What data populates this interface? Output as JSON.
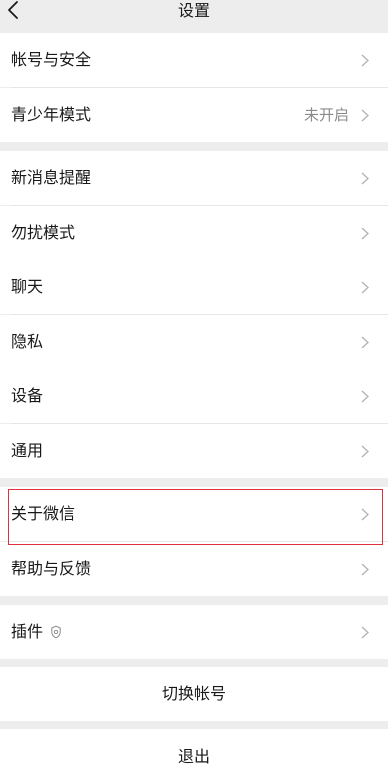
{
  "nav": {
    "title": "设置",
    "back_icon": "chevron-left-icon"
  },
  "sections": [
    {
      "items": [
        {
          "label": "帐号与安全",
          "value": ""
        },
        {
          "label": "青少年模式",
          "value": "未开启"
        }
      ]
    },
    {
      "items": [
        {
          "label": "新消息提醒"
        },
        {
          "label": "勿扰模式"
        },
        {
          "label": "聊天"
        },
        {
          "label": "隐私"
        },
        {
          "label": "设备"
        },
        {
          "label": "通用"
        }
      ]
    },
    {
      "items": [
        {
          "label": "关于微信"
        },
        {
          "label": "帮助与反馈"
        }
      ]
    },
    {
      "items": [
        {
          "label": "插件",
          "icon": "plugin-icon"
        }
      ]
    }
  ],
  "actions": {
    "switch_account": "切换帐号",
    "logout": "退出"
  },
  "colors": {
    "background": "#ededed",
    "highlight": "#e0313f",
    "secondary_text": "#8a8a8a"
  }
}
